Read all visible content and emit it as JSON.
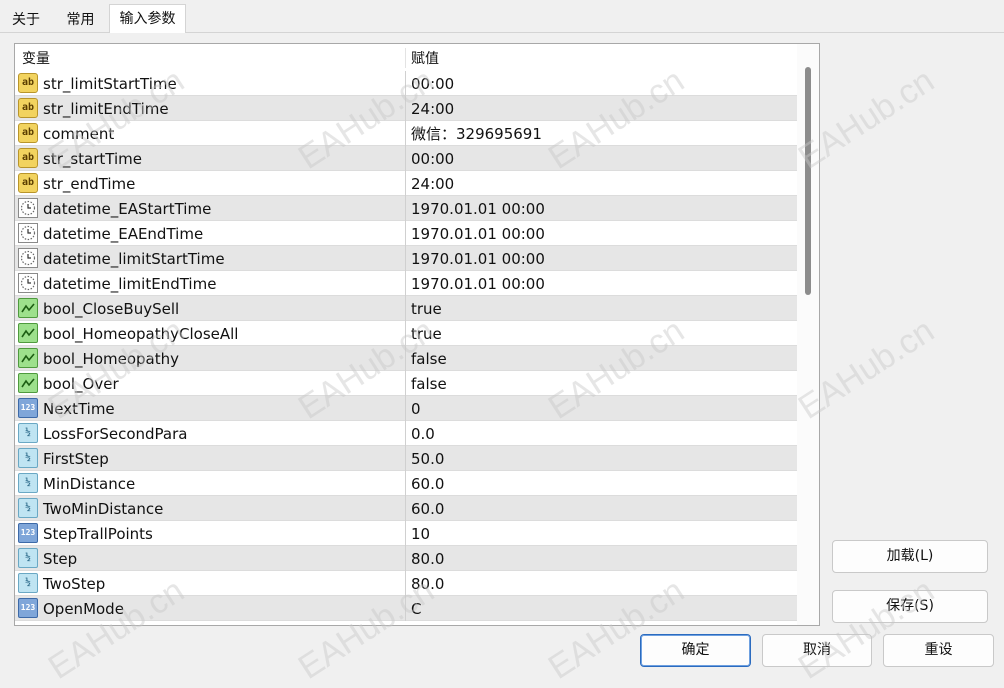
{
  "tabs": [
    {
      "label": "关于",
      "active": false
    },
    {
      "label": "常用",
      "active": false
    },
    {
      "label": "输入参数",
      "active": true
    }
  ],
  "grid": {
    "header": {
      "variable": "变量",
      "value": "赋值"
    },
    "rows": [
      {
        "icon": "string-icon",
        "name": "str_limitStartTime",
        "value": "00:00"
      },
      {
        "icon": "string-icon",
        "name": "str_limitEndTime",
        "value": "24:00"
      },
      {
        "icon": "string-icon",
        "name": "comment",
        "value": "微信：329695691"
      },
      {
        "icon": "string-icon",
        "name": "str_startTime",
        "value": "00:00"
      },
      {
        "icon": "string-icon",
        "name": "str_endTime",
        "value": "24:00"
      },
      {
        "icon": "datetime-icon",
        "name": "datetime_EAStartTime",
        "value": "1970.01.01 00:00"
      },
      {
        "icon": "datetime-icon",
        "name": "datetime_EAEndTime",
        "value": "1970.01.01 00:00"
      },
      {
        "icon": "datetime-icon",
        "name": "datetime_limitStartTime",
        "value": "1970.01.01 00:00"
      },
      {
        "icon": "datetime-icon",
        "name": "datetime_limitEndTime",
        "value": "1970.01.01 00:00"
      },
      {
        "icon": "bool-icon",
        "name": "bool_CloseBuySell",
        "value": "true"
      },
      {
        "icon": "bool-icon",
        "name": "bool_HomeopathyCloseAll",
        "value": "true"
      },
      {
        "icon": "bool-icon",
        "name": "bool_Homeopathy",
        "value": "false"
      },
      {
        "icon": "bool-icon",
        "name": "bool_Over",
        "value": "false"
      },
      {
        "icon": "integer-icon",
        "name": "NextTime",
        "value": "0"
      },
      {
        "icon": "double-icon",
        "name": "LossForSecondPara",
        "value": "0.0"
      },
      {
        "icon": "double-icon",
        "name": "FirstStep",
        "value": "50.0"
      },
      {
        "icon": "double-icon",
        "name": "MinDistance",
        "value": "60.0"
      },
      {
        "icon": "double-icon",
        "name": "TwoMinDistance",
        "value": "60.0"
      },
      {
        "icon": "integer-icon",
        "name": "StepTrallPoints",
        "value": "10"
      },
      {
        "icon": "double-icon",
        "name": "Step",
        "value": "80.0"
      },
      {
        "icon": "double-icon",
        "name": "TwoStep",
        "value": "80.0"
      },
      {
        "icon": "integer-icon",
        "name": "OpenMode",
        "value": "C"
      }
    ]
  },
  "side_buttons": {
    "load": "加载(L)",
    "save": "保存(S)"
  },
  "bottom_buttons": {
    "ok": "确定",
    "cancel": "取消",
    "reset": "重设"
  },
  "watermark": "EAHub.cn"
}
